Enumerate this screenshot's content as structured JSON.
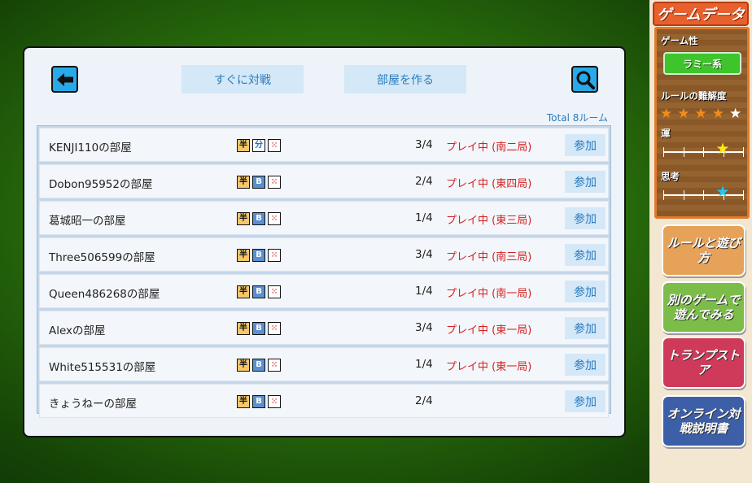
{
  "toolbar": {
    "quick_match_label": "すぐに対戦",
    "create_room_label": "部屋を作る"
  },
  "total_label": "Total 8ルーム",
  "rooms": [
    {
      "name": "KENJI110の部屋",
      "icons": [
        "半",
        "分",
        "⁙"
      ],
      "players": "3/4",
      "status": "プレイ中 (南二局)",
      "join_label": "参加"
    },
    {
      "name": "Dobon95952の部屋",
      "icons": [
        "半",
        "B",
        "⁙"
      ],
      "players": "2/4",
      "status": "プレイ中 (東四局)",
      "join_label": "参加"
    },
    {
      "name": "葛城昭一の部屋",
      "icons": [
        "半",
        "B",
        "⁙"
      ],
      "players": "1/4",
      "status": "プレイ中 (東三局)",
      "join_label": "参加"
    },
    {
      "name": "Three506599の部屋",
      "icons": [
        "半",
        "B",
        "⁙"
      ],
      "players": "3/4",
      "status": "プレイ中 (南三局)",
      "join_label": "参加"
    },
    {
      "name": "Queen486268の部屋",
      "icons": [
        "半",
        "B",
        "⁙"
      ],
      "players": "1/4",
      "status": "プレイ中 (南一局)",
      "join_label": "参加"
    },
    {
      "name": "Alexの部屋",
      "icons": [
        "半",
        "B",
        "⁙"
      ],
      "players": "3/4",
      "status": "プレイ中 (東一局)",
      "join_label": "参加"
    },
    {
      "name": "White515531の部屋",
      "icons": [
        "半",
        "B",
        "⁙"
      ],
      "players": "1/4",
      "status": "プレイ中 (東一局)",
      "join_label": "参加"
    },
    {
      "name": "きょうねーの部屋",
      "icons": [
        "半",
        "B",
        "⁙"
      ],
      "players": "2/4",
      "status": "",
      "join_label": "参加"
    }
  ],
  "sidebar": {
    "game_data_title": "ゲームデータ",
    "genre_label": "ゲーム性",
    "genre_value": "ラミー系",
    "difficulty_label": "ルールの難解度",
    "difficulty_stars": 4,
    "difficulty_max": 5,
    "luck_label": "運",
    "luck_level": 0.75,
    "thinking_label": "思考",
    "thinking_level": 0.75,
    "rules_button": "ルールと遊び方",
    "other_games_button": "別のゲームで遊んでみる",
    "store_button": "トランプストア",
    "manual_button": "オンライン対戦説明書"
  },
  "colors": {
    "accent": "#29a9e8",
    "status_red": "#d42020",
    "button_bg": "#d4e8f8",
    "button_text": "#2b7bbd"
  },
  "icons": {
    "back": "back-arrow-icon",
    "search": "magnifier-icon"
  }
}
